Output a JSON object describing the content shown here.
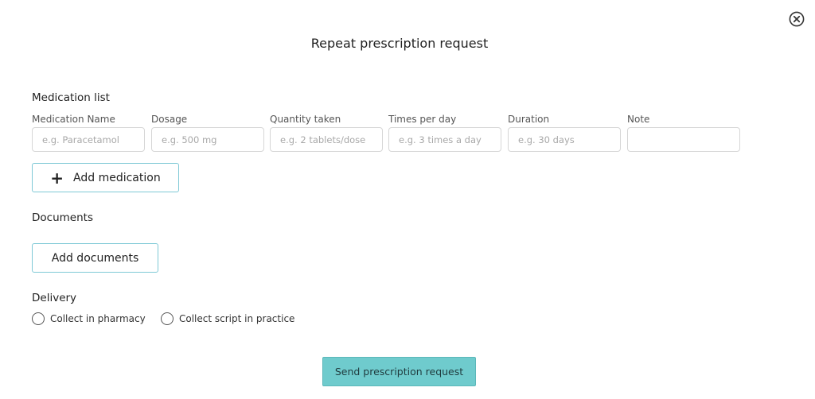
{
  "dialog": {
    "title": "Repeat prescription request",
    "close_icon": "close-circle-icon"
  },
  "medication": {
    "section_label": "Medication list",
    "columns": [
      {
        "label": "Medication Name",
        "placeholder": "e.g. Paracetamol"
      },
      {
        "label": "Dosage",
        "placeholder": "e.g. 500 mg"
      },
      {
        "label": "Quantity taken",
        "placeholder": "e.g. 2 tablets/dose"
      },
      {
        "label": "Times per day",
        "placeholder": "e.g. 3 times a day"
      },
      {
        "label": "Duration",
        "placeholder": "e.g. 30 days"
      },
      {
        "label": "Note",
        "placeholder": ""
      }
    ],
    "add_button_label": "Add medication",
    "add_icon": "plus-icon"
  },
  "documents": {
    "section_label": "Documents",
    "add_button_label": "Add documents"
  },
  "delivery": {
    "section_label": "Delivery",
    "options": [
      {
        "label": "Collect in pharmacy",
        "selected": false
      },
      {
        "label": "Collect script in practice",
        "selected": false
      }
    ]
  },
  "submit": {
    "label": "Send prescription request",
    "color": "#6fcbcd"
  }
}
